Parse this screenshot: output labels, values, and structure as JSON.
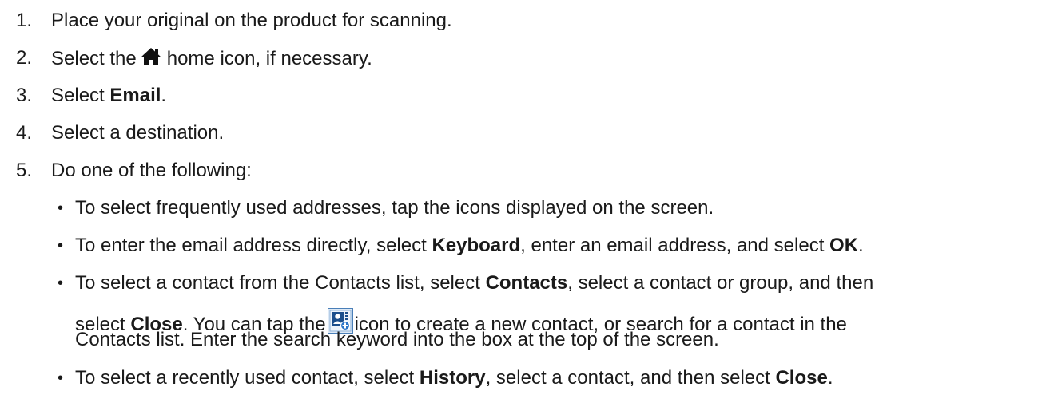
{
  "steps": [
    {
      "num": "1.",
      "text": "Place your original on the product for scanning."
    },
    {
      "num": "2.",
      "pre": "Select the",
      "post": "home icon, if necessary.",
      "icon": "home-icon"
    },
    {
      "num": "3.",
      "pre": "Select ",
      "bold": "Email",
      "post": "."
    },
    {
      "num": "4.",
      "text": "Select a destination."
    },
    {
      "num": "5.",
      "text": "Do one of the following:"
    }
  ],
  "bullets": [
    {
      "text": "To select frequently used addresses, tap the icons displayed on the screen."
    },
    {
      "pre": "To enter the email address directly, select ",
      "bold1": "Keyboard",
      "mid": ", enter an email address, and select ",
      "bold2": "OK",
      "post": "."
    },
    {
      "pre": "To select a contact from the Contacts list, select ",
      "bold1": "Contacts",
      "post": ", select a contact or group, and then"
    },
    {
      "pre": "select ",
      "bold1": "Close",
      "mid": ". You can tap the",
      "post": "icon to create a new contact, or search for a contact in the",
      "icon": "add-contact-icon"
    },
    {
      "text": "Contacts list. Enter the search keyword into the box at the top of the screen."
    },
    {
      "pre": "To select a recently used contact, select ",
      "bold1": "History",
      "mid": ", select a contact, and then select ",
      "bold2": "Close",
      "post": "."
    }
  ],
  "bullet_char": "•"
}
